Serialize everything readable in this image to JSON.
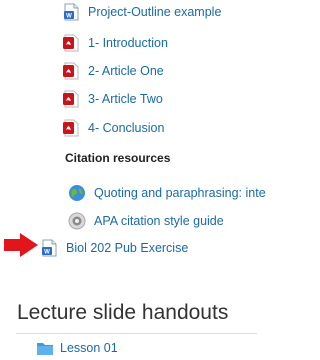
{
  "links": {
    "project_outline": "Project-Outline example",
    "introduction": "1- Introduction",
    "article_one": "2- Article One",
    "article_two": "3- Article Two",
    "conclusion": "4- Conclusion"
  },
  "citation_section": {
    "heading": "Citation resources",
    "quoting": "Quoting and paraphrasing: inte",
    "apa": "APA citation style guide"
  },
  "pub_exercise": "Biol 202 Pub Exercise",
  "lecture_section": {
    "heading": "Lecture slide handouts",
    "lesson_01": "Lesson 01"
  },
  "colors": {
    "link": "#1a6aa8",
    "pdf_red": "#c8151b",
    "arrow_red": "#e2141c",
    "folder_blue": "#3f9be0"
  }
}
